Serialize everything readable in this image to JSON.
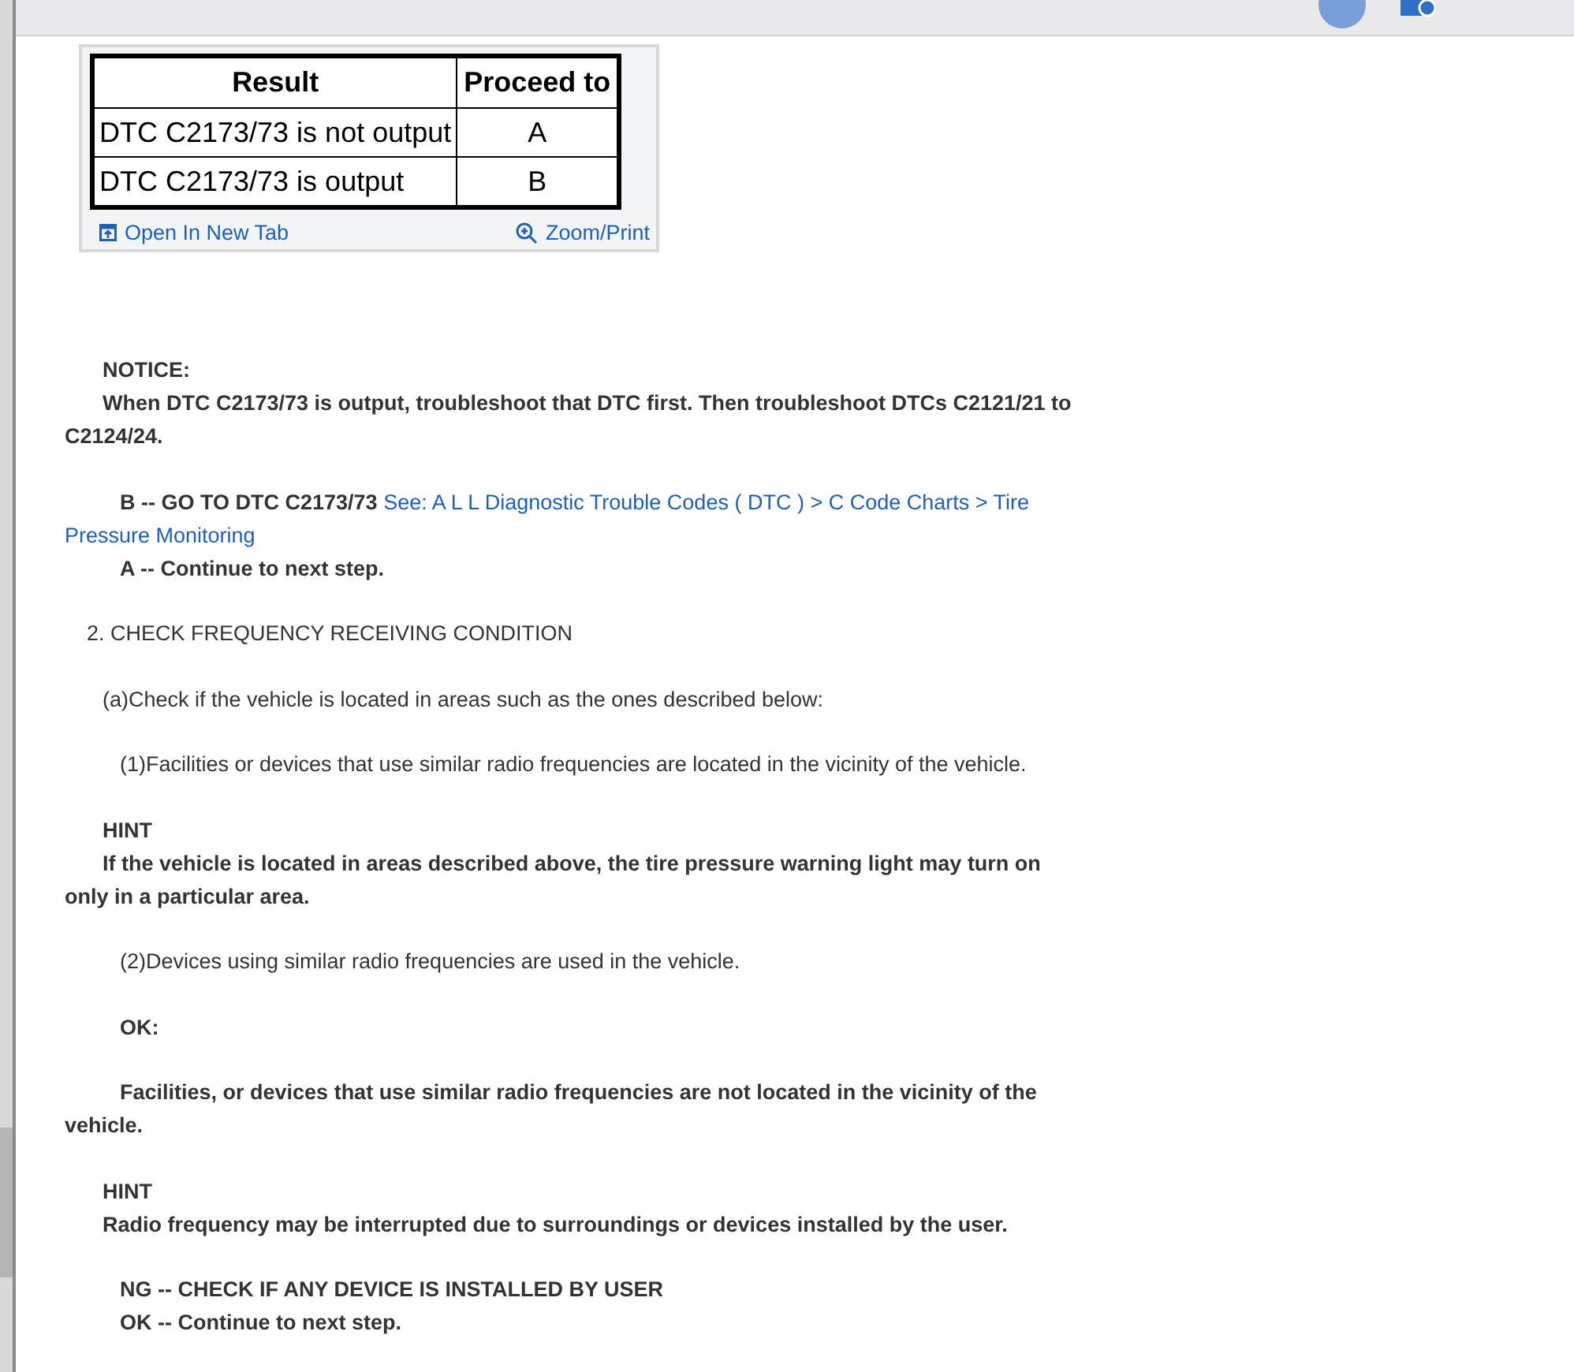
{
  "table": {
    "columns": [
      "Result",
      "Proceed to"
    ],
    "rows": [
      [
        "DTC C2173/73 is not output",
        "A"
      ],
      [
        "DTC C2173/73 is output",
        "B"
      ]
    ],
    "actions": [
      "Open In New Tab",
      "Zoom/Print"
    ]
  },
  "groups": [
    [
      {
        "kind": "label",
        "text": "NOTICE:"
      },
      {
        "kind": "note",
        "text": "When DTC C2173/73 is output, troubleshoot that DTC first. Then troubleshoot DTCs C2121/21 to C2124/24."
      }
    ],
    [
      {
        "kind": "result",
        "text": "B -- GO TO DTC C2173/73",
        "link": [
          "See: A L L Diagnostic Trouble Codes ( DTC ) > C Code Charts > Tire",
          "Pressure Monitoring"
        ]
      },
      {
        "kind": "result",
        "text": "A -- Continue to next step."
      }
    ],
    [
      {
        "kind": "step",
        "text": "2. CHECK FREQUENCY RECEIVING CONDITION"
      }
    ],
    [
      {
        "kind": "sub",
        "text": "(a)Check if the vehicle is located in areas such as the ones described below:"
      }
    ],
    [
      {
        "kind": "item",
        "text": "(1)Facilities or devices that use similar radio frequencies are located in the vicinity of the vehicle."
      }
    ],
    [
      {
        "kind": "label",
        "text": "HINT"
      },
      {
        "kind": "note",
        "text": "If the vehicle is located in areas described above, the tire pressure warning light may turn on only in a particular area."
      }
    ],
    [
      {
        "kind": "item",
        "text": "(2)Devices using similar radio frequencies are used in the vehicle."
      }
    ],
    [
      {
        "kind": "result",
        "text": "OK:"
      }
    ],
    [
      {
        "kind": "result",
        "text": "Facilities, or devices that use similar radio frequencies are not located in the vicinity of the vehicle."
      }
    ],
    [
      {
        "kind": "label",
        "text": "HINT"
      },
      {
        "kind": "note",
        "text": "Radio frequency may be interrupted due to surroundings or devices installed by the user."
      }
    ],
    [
      {
        "kind": "result",
        "text": "NG -- CHECK IF ANY DEVICE IS INSTALLED BY USER"
      },
      {
        "kind": "result",
        "text": "OK -- Continue to next step."
      }
    ]
  ]
}
